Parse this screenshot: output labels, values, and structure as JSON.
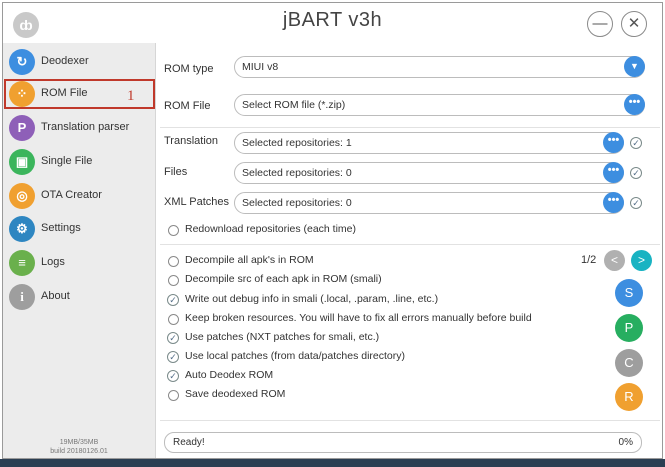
{
  "window": {
    "title": "jBART v3h",
    "minimize": "—",
    "close": "✕",
    "logo": "ȸ"
  },
  "colors": {
    "accent": "#3d8ee0",
    "selected_border": "#c0392b",
    "sidebar_bg": "#ececec"
  },
  "sidebar": {
    "items": [
      {
        "label": "Deodexer",
        "icon": "refresh-icon",
        "glyph": "↻",
        "color": "#3d8ee0"
      },
      {
        "label": "ROM File",
        "icon": "rom-file-icon",
        "glyph": "⁘",
        "color": "#f0a030"
      },
      {
        "label": "Translation parser",
        "icon": "p-letter-icon",
        "glyph": "P",
        "color": "#8e5fb8"
      },
      {
        "label": "Single File",
        "icon": "android-icon",
        "glyph": "▣",
        "color": "#3bb55c"
      },
      {
        "label": "OTA Creator",
        "icon": "ota-icon",
        "glyph": "◎",
        "color": "#f0a030"
      },
      {
        "label": "Settings",
        "icon": "gear-icon",
        "glyph": "⚙",
        "color": "#2e86c1"
      },
      {
        "label": "Logs",
        "icon": "logs-icon",
        "glyph": "≡",
        "color": "#6ab04c"
      },
      {
        "label": "About",
        "icon": "info-icon",
        "glyph": "i",
        "color": "#9e9e9e"
      }
    ],
    "selected": "ROM File",
    "annotation": "1",
    "memory": "19MB/35MB",
    "build": "build 20180126.01"
  },
  "main": {
    "rom_type": {
      "label": "ROM type",
      "value": "MIUI v8"
    },
    "rom_file": {
      "label": "ROM File",
      "placeholder": "Select ROM file (*.zip)"
    },
    "translation": {
      "label": "Translation",
      "value": "Selected repositories: 1"
    },
    "files": {
      "label": "Files",
      "value": "Selected repositories: 0"
    },
    "xml_patches": {
      "label": "XML Patches",
      "value": "Selected repositories: 0"
    },
    "redownload": "Redownload repositories (each time)",
    "dots": "•••",
    "tick": "✓",
    "page": "1/2",
    "prev": "<",
    "next": ">",
    "options": [
      {
        "label": "Decompile all apk's in ROM",
        "checked": false
      },
      {
        "label": "Decompile src of each apk in ROM (smali)",
        "checked": false
      },
      {
        "label": "Write out debug info in smali (.local, .param, .line, etc.)",
        "checked": true
      },
      {
        "label": "Keep broken resources. You will have to fix all errors manually before build",
        "checked": false
      },
      {
        "label": "Use patches (NXT patches for smali, etc.)",
        "checked": true
      },
      {
        "label": "Use local patches (from data/patches directory)",
        "checked": true
      },
      {
        "label": "Auto Deodex ROM",
        "checked": true
      },
      {
        "label": "Save deodexed ROM",
        "checked": false
      }
    ],
    "actions": [
      {
        "label": "S",
        "color": "#3d8ee0"
      },
      {
        "label": "P",
        "color": "#27ae60"
      },
      {
        "label": "C",
        "color": "#9e9e9e"
      },
      {
        "label": "R",
        "color": "#f0a030"
      }
    ],
    "status": {
      "text": "Ready!",
      "progress": "0%"
    }
  }
}
